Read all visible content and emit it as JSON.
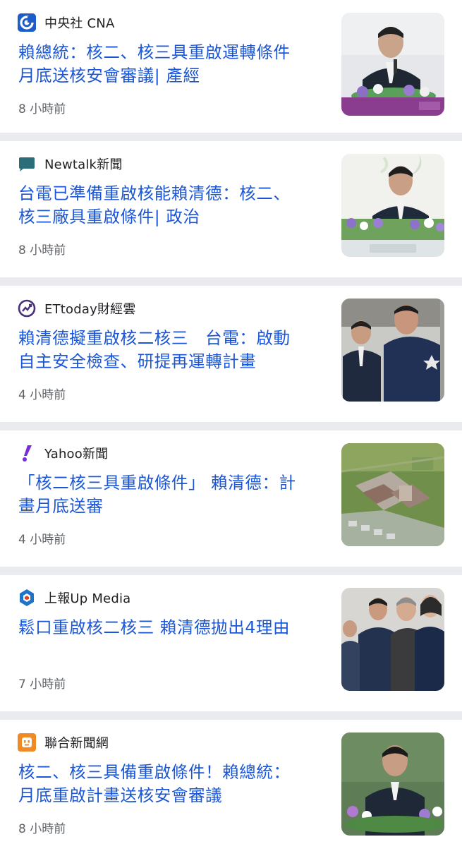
{
  "articles": [
    {
      "source": "中央社 CNA",
      "source_icon": "cna-logo-icon",
      "headline": "賴總統：核二、核三具重啟運轉條件\n月底送核安會審議| 產經",
      "time": "8 小時前",
      "thumbnail": "president-speaking-podium-image"
    },
    {
      "source": "Newtalk新聞",
      "source_icon": "newtalk-logo-icon",
      "headline": "台電已準備重啟核能賴清德：核二、\n核三廠具重啟條件| 政治",
      "time": "8 小時前",
      "thumbnail": "president-speaking-flowers-image"
    },
    {
      "source": "ETtoday財經雲",
      "source_icon": "ettoday-logo-icon",
      "headline": "賴清德擬重啟核二核三　台電：啟動\n自主安全檢查、研提再運轉計畫",
      "time": "4 小時前",
      "thumbnail": "president-and-official-image"
    },
    {
      "source": "Yahoo新聞",
      "source_icon": "yahoo-logo-icon",
      "headline": "「核二核三具重啟條件」 賴清德：計\n畫月底送審",
      "time": "4 小時前",
      "thumbnail": "nuclear-plant-aerial-image"
    },
    {
      "source": "上報Up Media",
      "source_icon": "upmedia-logo-icon",
      "headline": "鬆口重啟核二核三 賴清德拋出4理由",
      "time": "7 小時前",
      "thumbnail": "president-group-walking-image"
    },
    {
      "source": "聯合新聞網",
      "source_icon": "udn-logo-icon",
      "headline": "核二、核三具備重啟條件！賴總統：\n月底重啟計畫送核安會審議",
      "time": "8 小時前",
      "thumbnail": "president-portrait-flowers-image"
    }
  ],
  "colors": {
    "headline": "#1a56d6",
    "source_text": "#202124",
    "time_text": "#5f6368",
    "separator": "#e9ebee"
  }
}
